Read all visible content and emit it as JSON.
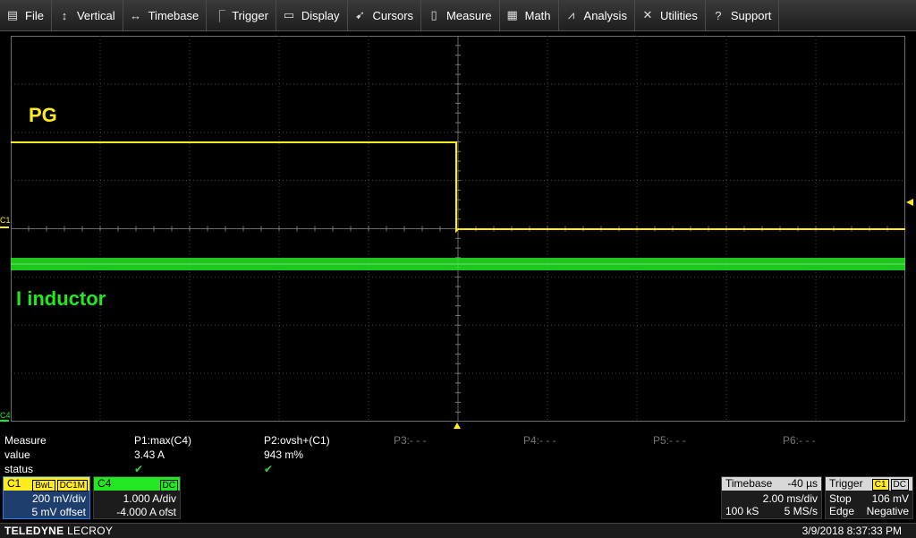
{
  "menu": [
    {
      "label": "File",
      "icon": "file-icon",
      "glyph": "▤"
    },
    {
      "label": "Vertical",
      "icon": "vertical-arrows-icon",
      "glyph": "↕"
    },
    {
      "label": "Timebase",
      "icon": "horizontal-arrows-icon",
      "glyph": "↔"
    },
    {
      "label": "Trigger",
      "icon": "trigger-icon",
      "glyph": "⎾"
    },
    {
      "label": "Display",
      "icon": "display-icon",
      "glyph": "▭"
    },
    {
      "label": "Cursors",
      "icon": "cursor-icon",
      "glyph": "➹"
    },
    {
      "label": "Measure",
      "icon": "measure-icon",
      "glyph": "▯"
    },
    {
      "label": "Math",
      "icon": "math-icon",
      "glyph": "▦"
    },
    {
      "label": "Analysis",
      "icon": "analysis-icon",
      "glyph": "⩘"
    },
    {
      "label": "Utilities",
      "icon": "utilities-icon",
      "glyph": "✕"
    },
    {
      "label": "Support",
      "icon": "support-icon",
      "glyph": "?"
    }
  ],
  "traces": {
    "pg": {
      "label": "PG",
      "color": "#ffeb1e"
    },
    "inductor": {
      "label": "I inductor",
      "color": "#22e722"
    }
  },
  "markers": {
    "c1": "C1",
    "c4": "C4"
  },
  "measure": {
    "row_labels": {
      "measure": "Measure",
      "value": "value",
      "status": "status"
    },
    "params": [
      {
        "name": "P1:max(C4)",
        "value": "3.43 A",
        "ok": true
      },
      {
        "name": "P2:ovsh+(C1)",
        "value": "943 m%",
        "ok": true
      },
      {
        "name": "P3:- - -",
        "value": "",
        "ok": false
      },
      {
        "name": "P4:- - -",
        "value": "",
        "ok": false
      },
      {
        "name": "P5:- - -",
        "value": "",
        "ok": false
      },
      {
        "name": "P6:- - -",
        "value": "",
        "ok": false
      }
    ],
    "check_glyph": "✔"
  },
  "c1": {
    "name": "C1",
    "tags": [
      "BwL",
      "DC1M"
    ],
    "scale": "200 mV/div",
    "offset": "5 mV offset",
    "color": "#ffeb1e"
  },
  "c4": {
    "name": "C4",
    "tags": [
      "DC"
    ],
    "scale": "1.000 A/div",
    "offset": "-4.000 A ofst",
    "color": "#22e722"
  },
  "timebase": {
    "label": "Timebase",
    "delay": "-40 µs",
    "scale": "2.00 ms/div",
    "samples": "100 kS",
    "rate": "5 MS/s"
  },
  "trigger": {
    "label": "Trigger",
    "tags": [
      "C1",
      "DC"
    ],
    "mode": "Stop",
    "level": "106 mV",
    "type": "Edge",
    "slope": "Negative"
  },
  "footer": {
    "brand_bold": "TELEDYNE",
    "brand_light": "LECROY",
    "timestamp": "3/9/2018 8:37:33 PM"
  }
}
